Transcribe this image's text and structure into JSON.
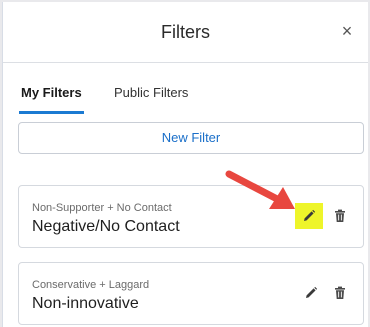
{
  "header": {
    "title": "Filters",
    "close_glyph": "×"
  },
  "tabs": [
    {
      "label": "My Filters",
      "active": true
    },
    {
      "label": "Public Filters",
      "active": false
    }
  ],
  "new_filter_label": "New Filter",
  "filters": [
    {
      "criteria": "Non-Supporter + No Contact",
      "name": "Negative/No Contact",
      "edit_icon": "pencil-icon",
      "delete_icon": "trash-icon",
      "edit_highlighted": true
    },
    {
      "criteria": "Conservative + Laggard",
      "name": "Non-innovative",
      "edit_icon": "pencil-icon",
      "delete_icon": "trash-icon",
      "edit_highlighted": false
    }
  ],
  "colors": {
    "accent": "#1b7ad2",
    "link": "#1a6fc9",
    "highlight": "#eef52a",
    "arrow": "#e8473f"
  }
}
